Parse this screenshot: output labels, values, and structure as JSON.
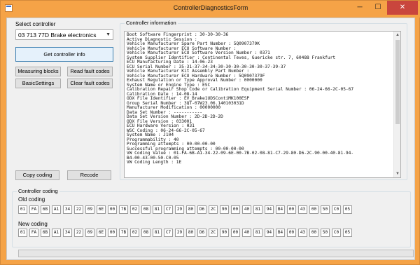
{
  "window": {
    "title": "ControllerDiagnosticsForm",
    "controls": {
      "minimize": "─",
      "maximize": "☐",
      "close": "✕"
    }
  },
  "left_panel": {
    "select_label": "Select controller",
    "selected_controller": "03 713 77D Brake electronics",
    "buttons": {
      "get_info": "Get controller info",
      "measuring_blocks": "Measuring blocks",
      "read_fault_codes": "Read fault codes",
      "basic_settings": "BasicSettings",
      "clear_fault_codes": "Clear fault codes",
      "copy_coding": "Copy coding",
      "recode": "Recode"
    }
  },
  "controller_info": {
    "group_title": "Controller information",
    "lines": [
      "Boot Software Fingerprint : 30-30-30-36",
      "Active Diagnostic Session :",
      "Vehicle Manufacturer Spare Part Number : 5Q0907379K",
      "Vehicle Manufacturer ECU Software Number :",
      "Vehicle Manufacturer ECU Software Version Number : 0371",
      "System Supplier Identifier : Continental Teves, Guericke str. 7, 60488 Frankfurt",
      "ECU Manufacturing Date : 14-06-23",
      "ECU Serial Number : 35-31-37-34-34-30-30-30-30-30-30-37-39-37",
      "Vehicle Manufacturer Kit Assembly Part Number :",
      "Vehicle Manufacturer ECU Hardware Number : 5Q0907379F",
      "Exhaust Regulation or Type Approval Number : 0000000",
      "System Name or Engine Type : ESC",
      "Calibration Repair Shop Code or Calibration Equipment Serial Number : 06-24-66-2C-05-67",
      "Calibration Date : 14-08-14",
      "ODX File Identifier : EV_Brake1UDSContiMK100ESP",
      "Group Serial Number : 3QT-07W23.06.140103031D",
      "Manufacturer Modification : 00000000",
      "Data Set Number : -----------",
      "Data Set Version Number : 2D-2D-2D-2D",
      "ODX File Version : 033001",
      "ECU Hardware Version : H31",
      "WSC Coding : 06-24-66-2C-05-67",
      "System Name : J104",
      "Programmability : 40",
      "Programming attempts : 00-00-00-00",
      "Successful programming attempts : 00-00-00-00",
      "VW Coding Value : 01-FA-6B-A1-34-22-09-6E-00-7B-02-08-81-C7-29-80-D6-2C-90-00-40-81-94-",
      "B4-00-43-00-50-C0-05",
      "VW Coding Length : 1E"
    ]
  },
  "coding": {
    "group_title": "Controller coding",
    "old_label": "Old coding",
    "new_label": "New coding",
    "old_bytes": [
      "01",
      "FA",
      "6B",
      "A1",
      "34",
      "22",
      "09",
      "6E",
      "00",
      "7B",
      "02",
      "08",
      "81",
      "C7",
      "29",
      "80",
      "D6",
      "2C",
      "90",
      "00",
      "40",
      "81",
      "94",
      "B4",
      "00",
      "43",
      "00",
      "50",
      "C0",
      "05"
    ],
    "new_bytes": [
      "01",
      "FA",
      "6B",
      "A1",
      "34",
      "22",
      "09",
      "6E",
      "00",
      "7B",
      "02",
      "08",
      "81",
      "C7",
      "29",
      "80",
      "D6",
      "2C",
      "90",
      "00",
      "40",
      "81",
      "94",
      "B4",
      "00",
      "43",
      "00",
      "50",
      "C0",
      "05"
    ]
  },
  "progress": {
    "value": 0
  },
  "icons": {
    "app": "app-window-icon",
    "dropdown": "chevron-down-icon"
  }
}
